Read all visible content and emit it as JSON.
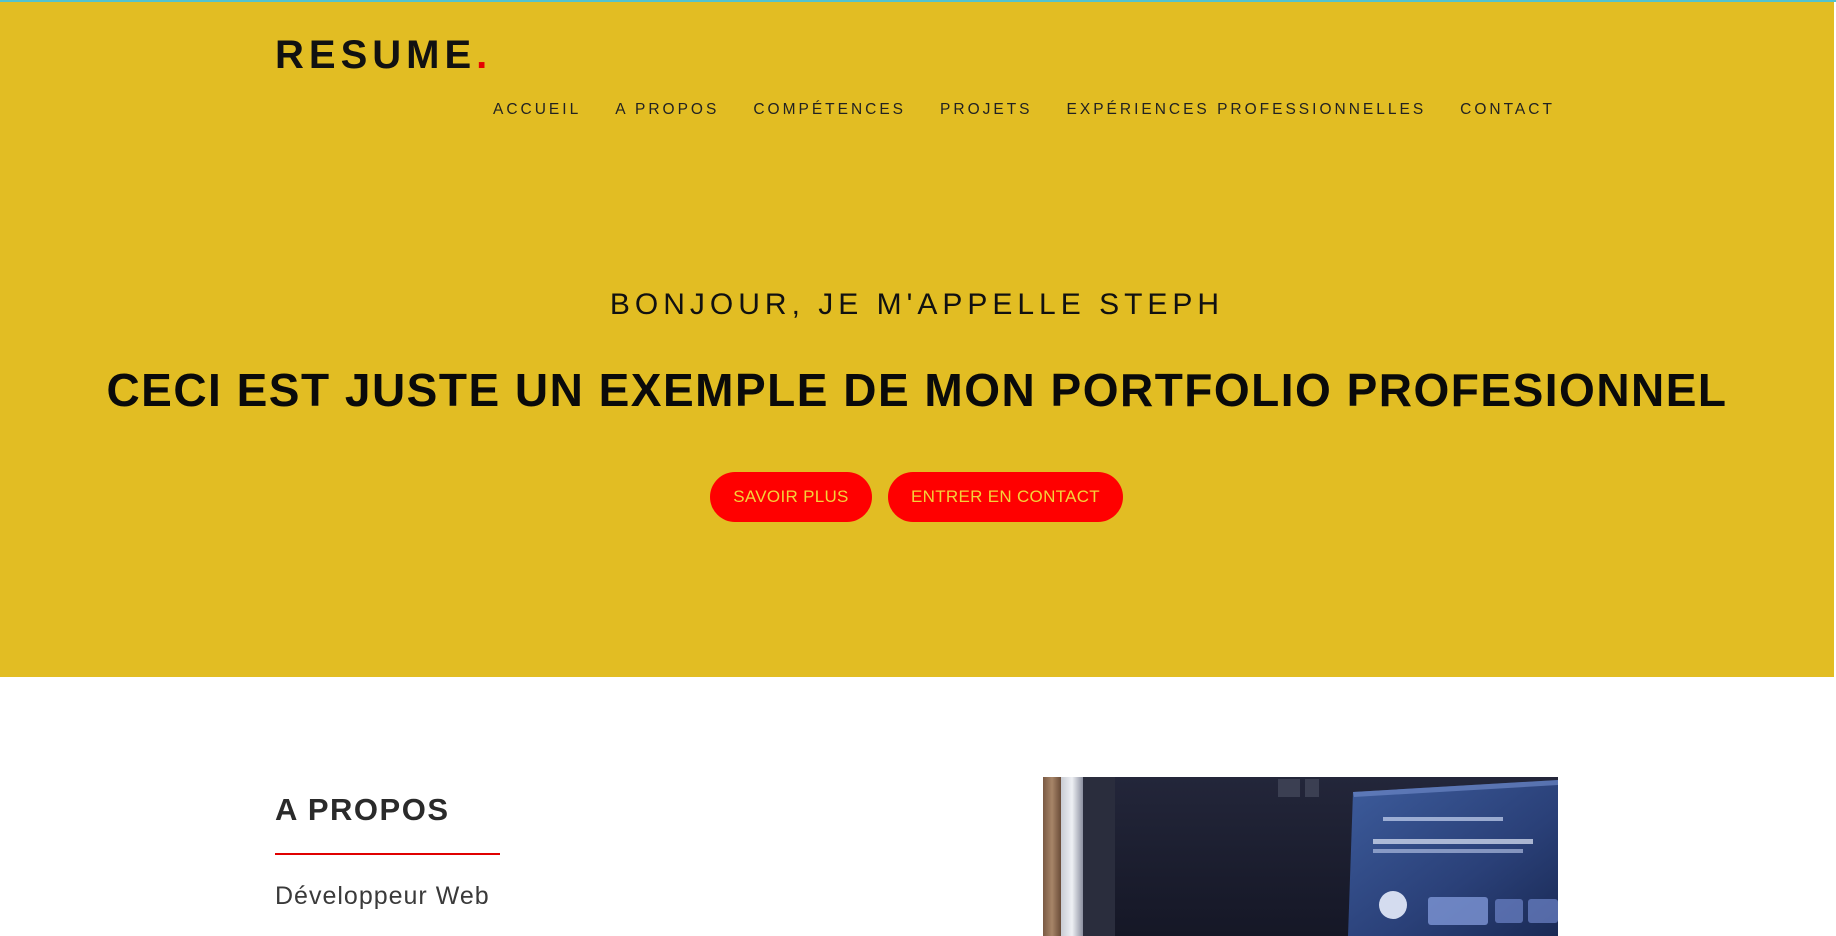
{
  "brand": {
    "logo_text": "RESUME",
    "logo_dot": ".",
    "accent_color": "#ff0000",
    "hero_background": "#e2bd23"
  },
  "nav": {
    "items": [
      {
        "label": "ACCUEIL"
      },
      {
        "label": "A PROPOS"
      },
      {
        "label": "COMPÉTENCES"
      },
      {
        "label": "PROJETS"
      },
      {
        "label": "EXPÉRIENCES PROFESSIONNELLES"
      },
      {
        "label": "CONTACT"
      }
    ]
  },
  "hero": {
    "greeting": "BONJOUR, JE M'APPELLE STEPH",
    "title": "CECI EST JUSTE UN EXEMPLE DE MON PORTFOLIO PROFESIONNEL",
    "buttons": {
      "more_label": "SAVOIR PLUS",
      "contact_label": "ENTRER EN CONTACT"
    }
  },
  "about": {
    "title": "A PROPOS",
    "subtitle": "Développeur Web"
  }
}
